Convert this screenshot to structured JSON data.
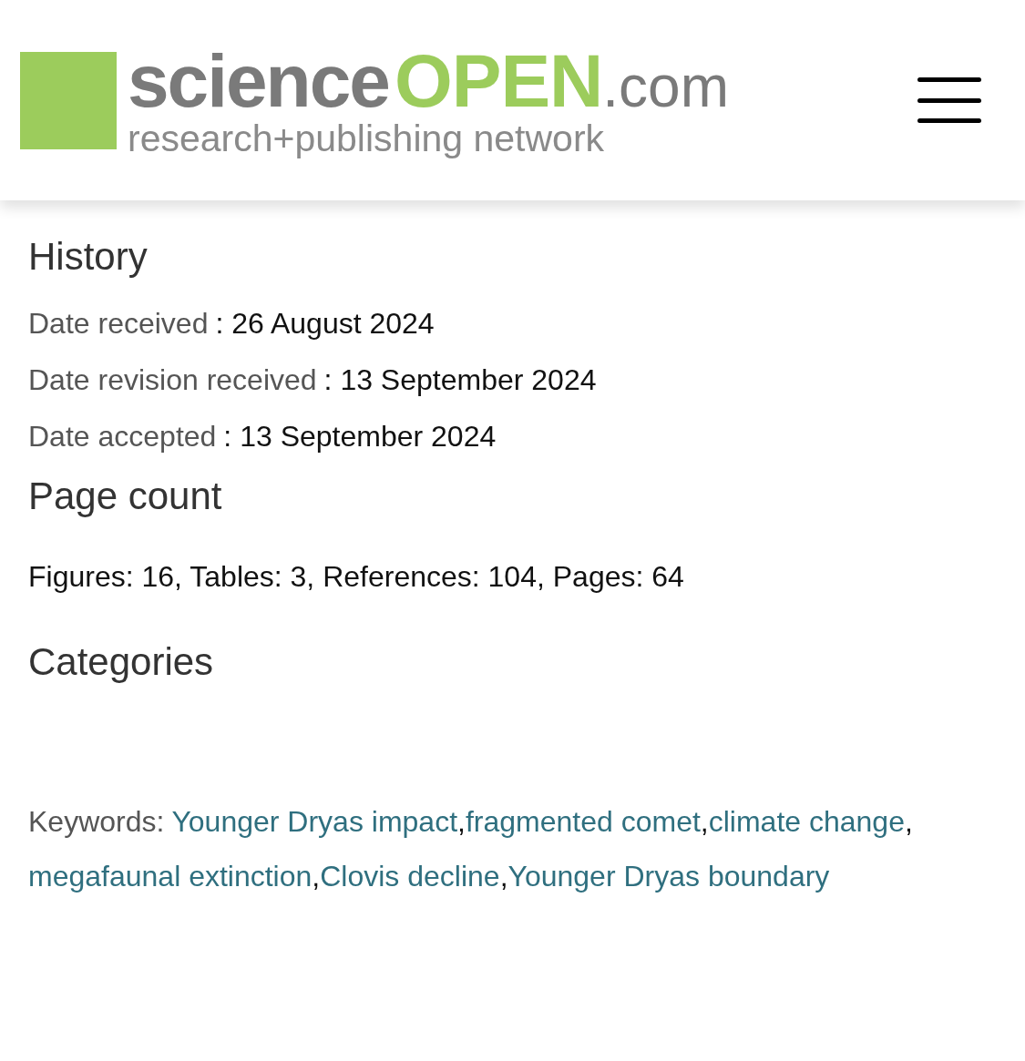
{
  "header": {
    "logo": {
      "part_1": "science",
      "part_2": "OPEN",
      "part_3": ".com",
      "tagline": "research+publishing network"
    }
  },
  "history": {
    "title": "History",
    "rows": [
      {
        "label": "Date received",
        "value": ": 26 August 2024"
      },
      {
        "label": "Date revision received",
        "value": ": 13 September 2024"
      },
      {
        "label": "Date accepted",
        "value": ": 13 September 2024"
      }
    ]
  },
  "page_count": {
    "title": "Page count",
    "text": "Figures: 16, Tables: 3, References: 104, Pages: 64"
  },
  "categories": {
    "title": "Categories"
  },
  "keywords": {
    "label": "Keywords:",
    "separator": ",",
    "items": [
      "Younger Dryas impact",
      "fragmented comet",
      "climate change",
      "megafaunal extinction",
      "Clovis decline",
      "Younger Dryas boundary"
    ]
  }
}
